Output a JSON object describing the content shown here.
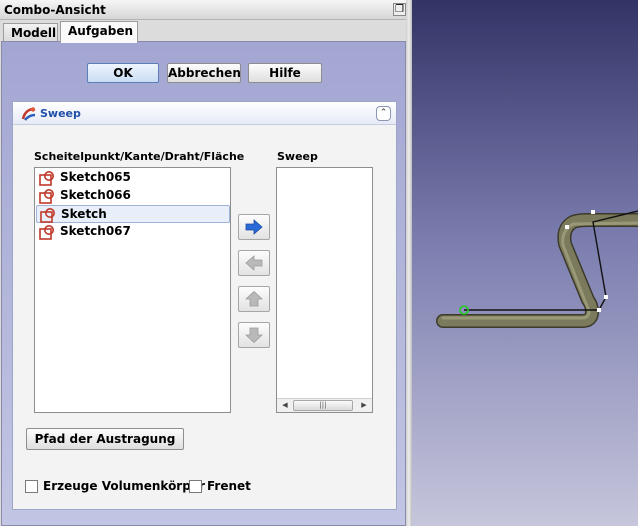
{
  "dock": {
    "title": "Combo-Ansicht",
    "tabs": [
      "Modell",
      "Aufgaben"
    ]
  },
  "dialog": {
    "ok": "OK",
    "cancel": "Abbrechen",
    "help": "Hilfe"
  },
  "sweep": {
    "title": "Sweep",
    "available_label": "Scheitelpunkt/Kante/Draht/Fläche",
    "selected_label": "Sweep",
    "available_items": [
      "Sketch065",
      "Sketch066",
      "Sketch",
      "Sketch067"
    ],
    "selected_index": 2,
    "selected_items": [],
    "path_button": "Pfad der Austragung",
    "solid_checkbox": "Erzeuge Volumenkörper",
    "frenet_checkbox": "Frenet",
    "solid_checked": false,
    "frenet_checked": false
  },
  "icons": {
    "panel": "sweep-icon",
    "item": "sketch-icon",
    "move_right": "arrow-right-icon",
    "move_left": "arrow-left-icon",
    "move_up": "arrow-up-icon",
    "move_down": "arrow-down-icon",
    "collapse": "chevron-up-icon",
    "float": "float-window-icon"
  },
  "colors": {
    "panel_title": "#1f4fa8",
    "arrow_active": "#2a6ad8",
    "pipe": "#7b7a5c",
    "viewport_top": "#333366",
    "viewport_bottom": "#c6c6dc"
  }
}
